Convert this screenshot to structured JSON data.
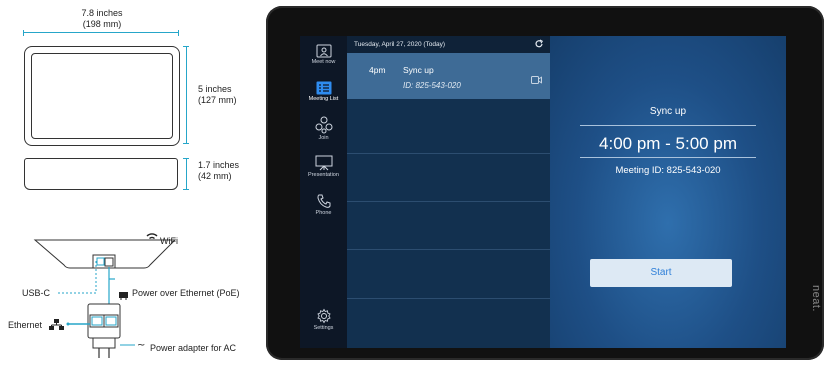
{
  "specs": {
    "width_label": "7.8 inches\n(198 mm)",
    "height_label": "5 inches\n(127 mm)",
    "depth_label": "1.7 inches\n(42 mm)",
    "wifi_label": "WiFi",
    "usbc_label": "USB-C",
    "poe_label": "Power over Ethernet (PoE)",
    "ethernet_label": "Ethernet",
    "ac_label": "Power adapter for AC"
  },
  "sidebar": {
    "items": [
      {
        "label": "Meet now",
        "icon": "meet-now-icon"
      },
      {
        "label": "Meeting List",
        "icon": "list-icon"
      },
      {
        "label": "Join",
        "icon": "join-icon"
      },
      {
        "label": "Presentation",
        "icon": "presentation-icon"
      },
      {
        "label": "Phone",
        "icon": "phone-icon"
      },
      {
        "label": "Settings",
        "icon": "gear-icon"
      }
    ]
  },
  "list": {
    "date_header": "Tuesday, April 27, 2020 (Today)",
    "meetings": [
      {
        "time": "4pm",
        "title": "Sync up",
        "id": "ID: 825-543-020"
      }
    ]
  },
  "detail": {
    "title": "Sync up",
    "time_range": "4:00 pm - 5:00 pm",
    "meeting_id": "Meeting ID: 825-543-020",
    "start_label": "Start"
  },
  "brand": "neat."
}
